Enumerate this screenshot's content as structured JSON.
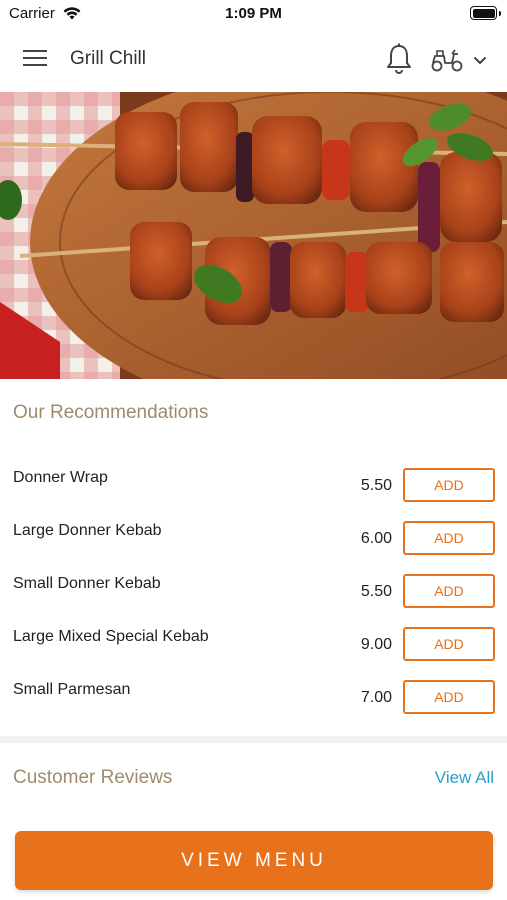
{
  "status_bar": {
    "carrier": "Carrier",
    "time": "1:09 PM"
  },
  "header": {
    "title": "Grill Chill",
    "icons": [
      "hamburger-menu-icon",
      "bell-icon",
      "scooter-delivery-icon",
      "chevron-down-icon"
    ]
  },
  "hero": {
    "image": "grilled kebab skewers with peppers, onion and basil on wooden board"
  },
  "recommendations": {
    "title": "Our Recommendations",
    "add_label": "ADD",
    "items": [
      {
        "name": "Donner Wrap",
        "price": "5.50"
      },
      {
        "name": "Large Donner Kebab",
        "price": "6.00"
      },
      {
        "name": "Small Donner Kebab",
        "price": "5.50"
      },
      {
        "name": "Large Mixed Special Kebab",
        "price": "9.00"
      },
      {
        "name": "Small Parmesan",
        "price": "7.00"
      }
    ]
  },
  "reviews": {
    "title": "Customer Reviews",
    "view_all": "View All"
  },
  "footer": {
    "view_menu": "VIEW MENU"
  },
  "colors": {
    "accent": "#e8711c",
    "section_title": "#a08a6e",
    "link": "#2aa0c9"
  }
}
